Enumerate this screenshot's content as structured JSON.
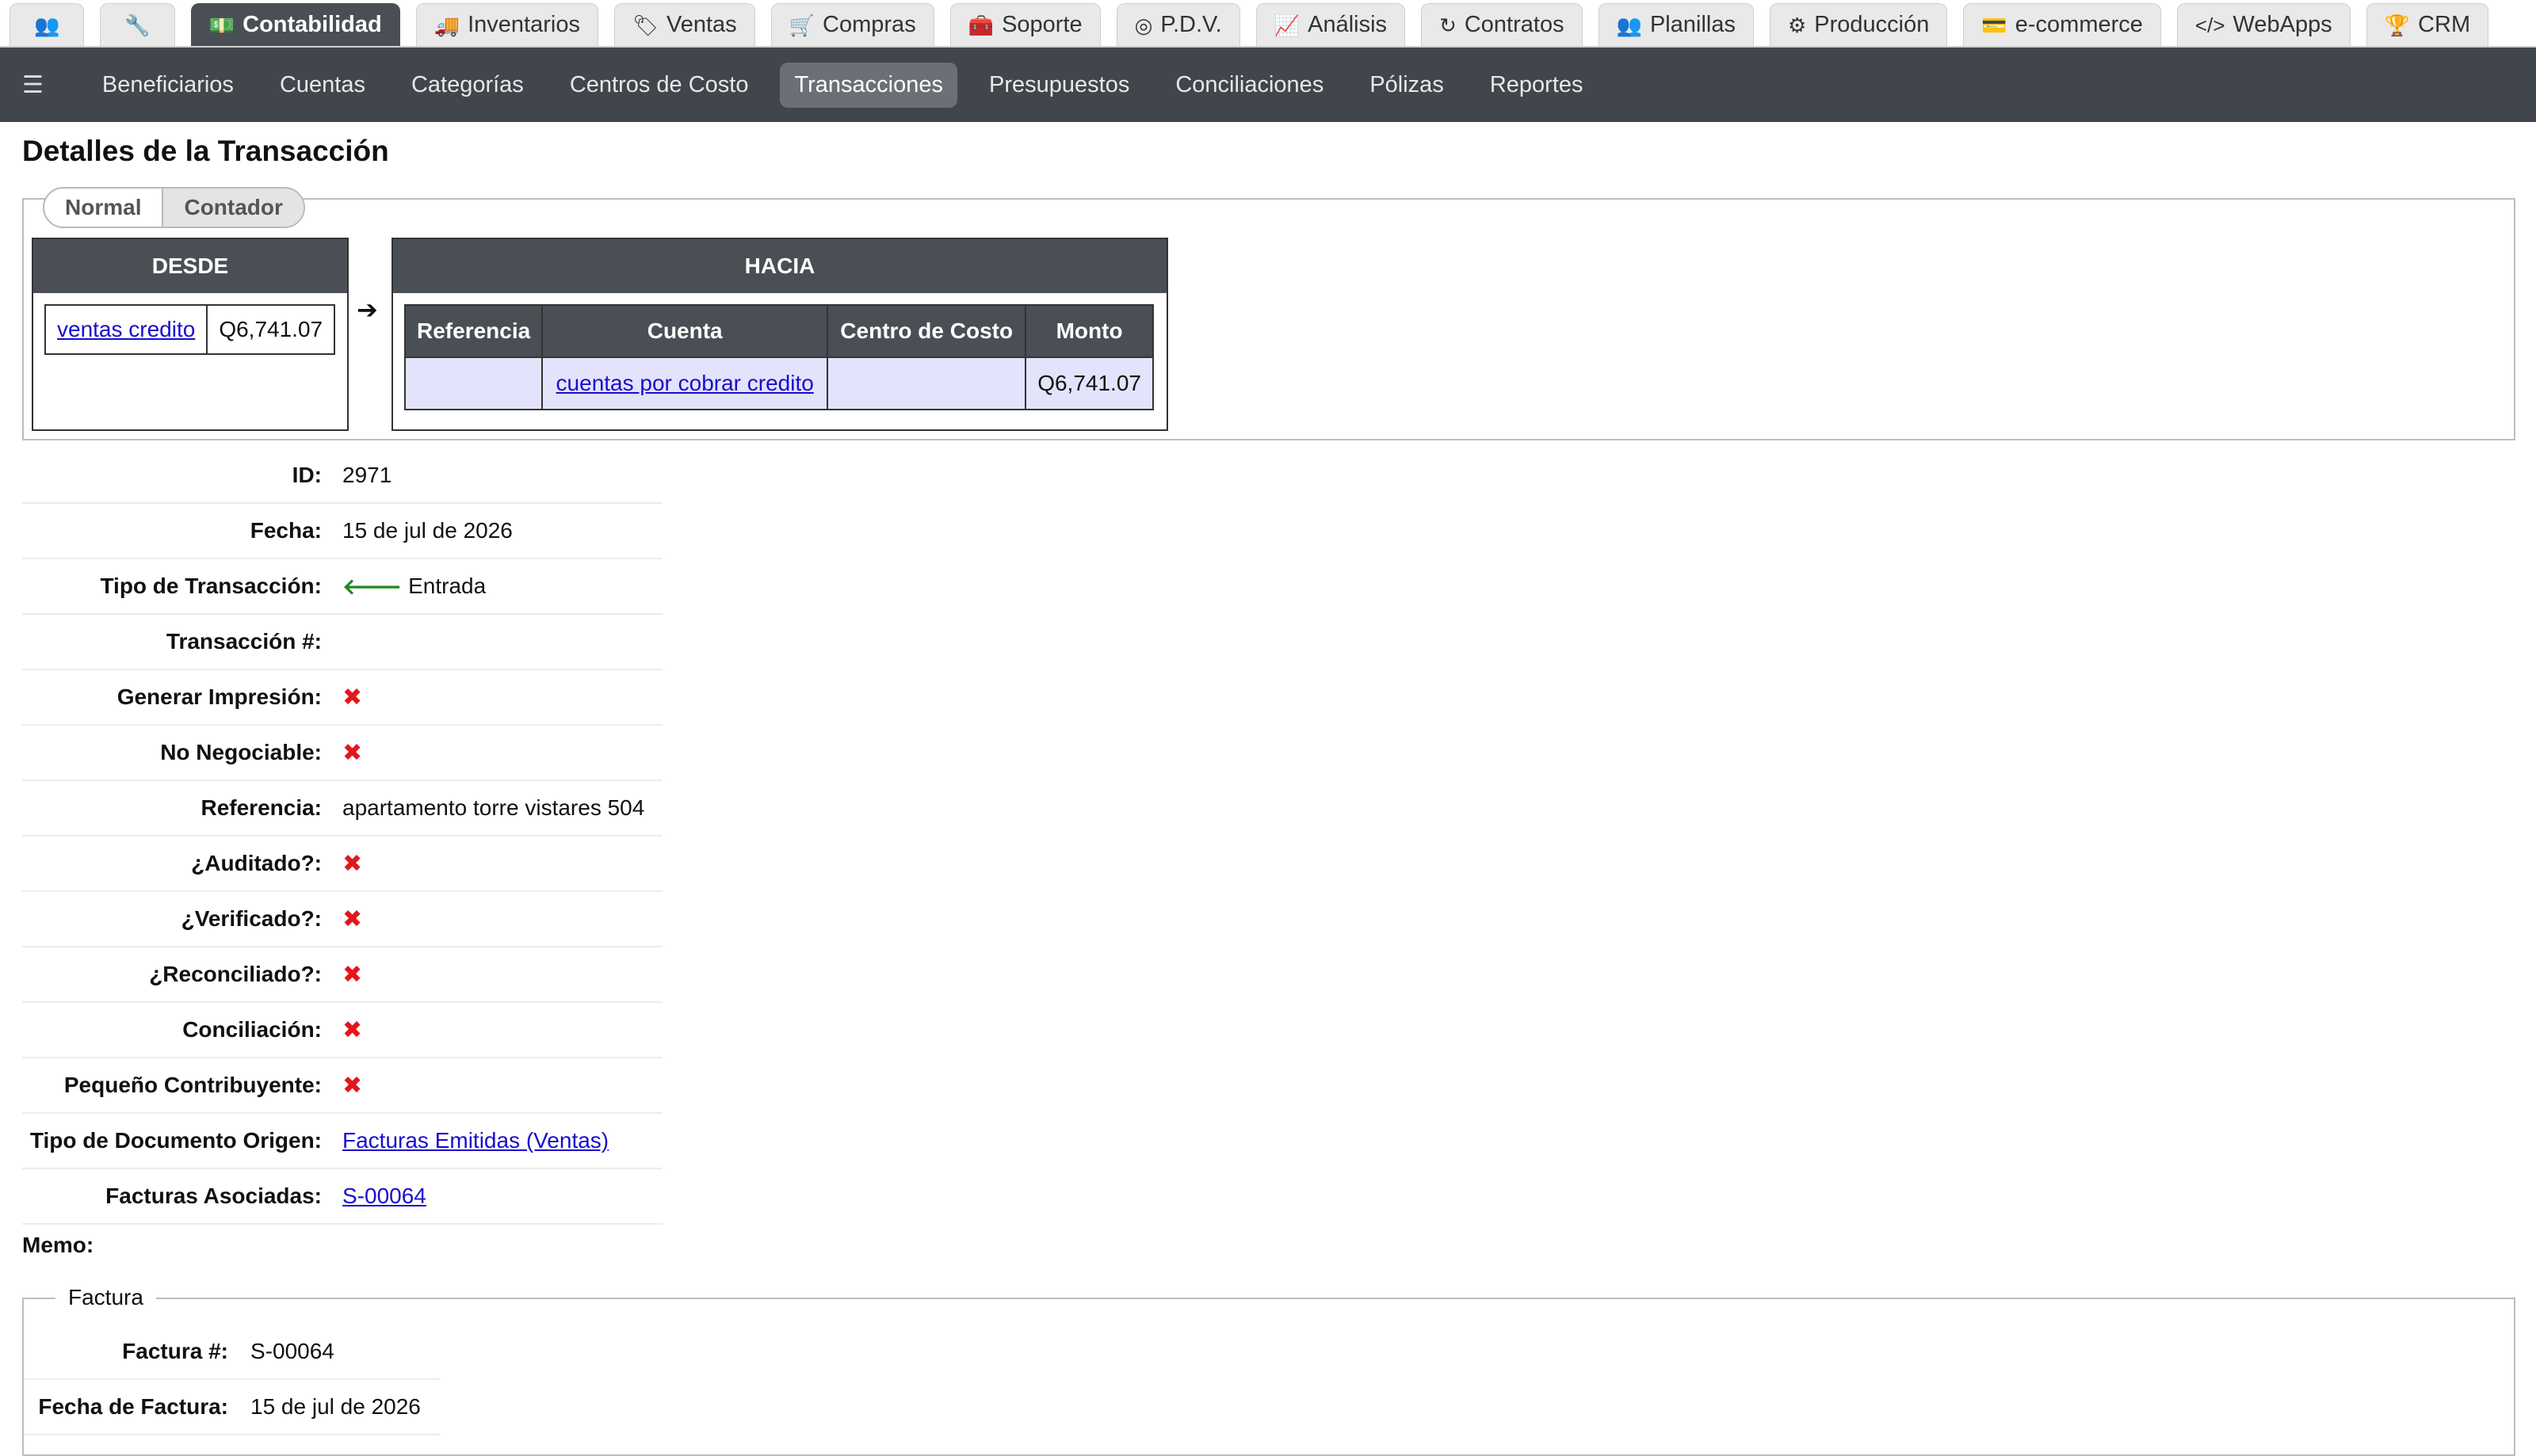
{
  "top_tabs": [
    {
      "name": "users-icon",
      "label": "",
      "icon": "👥"
    },
    {
      "name": "wrench-icon",
      "label": "",
      "icon": "🔧"
    },
    {
      "name": "accounting-icon",
      "label": "Contabilidad",
      "icon": "💵",
      "active": true
    },
    {
      "name": "truck-icon",
      "label": "Inventarios",
      "icon": "🚚"
    },
    {
      "name": "tag-icon",
      "label": "Ventas",
      "icon": "🏷"
    },
    {
      "name": "cart-icon",
      "label": "Compras",
      "icon": "🛒"
    },
    {
      "name": "medkit-icon",
      "label": "Soporte",
      "icon": "🧰"
    },
    {
      "name": "pos-icon",
      "label": "P.D.V.",
      "icon": "◎"
    },
    {
      "name": "chart-icon",
      "label": "Análisis",
      "icon": "📈"
    },
    {
      "name": "refresh-icon",
      "label": "Contratos",
      "icon": "↻"
    },
    {
      "name": "people-icon",
      "label": "Planillas",
      "icon": "👥"
    },
    {
      "name": "gears-icon",
      "label": "Producción",
      "icon": "⚙"
    },
    {
      "name": "card-icon",
      "label": "e-commerce",
      "icon": "💳"
    },
    {
      "name": "code-icon",
      "label": "WebApps",
      "icon": "</>"
    },
    {
      "name": "trophy-icon",
      "label": "CRM",
      "icon": "🏆"
    }
  ],
  "sub_nav": {
    "items": [
      "Beneficiarios",
      "Cuentas",
      "Categorías",
      "Centros de Costo",
      "Transacciones",
      "Presupuestos",
      "Conciliaciones",
      "Pólizas",
      "Reportes"
    ],
    "active_index": 4
  },
  "page": {
    "title": "Detalles de la Transacción",
    "view_options": [
      "Normal",
      "Contador"
    ]
  },
  "desde": {
    "title": "DESDE",
    "account": "ventas credito",
    "amount": "Q6,741.07"
  },
  "hacia": {
    "title": "HACIA",
    "headers": [
      "Referencia",
      "Cuenta",
      "Centro de Costo",
      "Monto"
    ],
    "row": {
      "referencia": "",
      "cuenta": "cuentas por cobrar credito",
      "centro": "",
      "monto": "Q6,741.07"
    }
  },
  "details": [
    {
      "label": "ID:",
      "value": "2971",
      "type": "text"
    },
    {
      "label": "Fecha:",
      "value": "15 de jul de 2026",
      "type": "text"
    },
    {
      "label": "Tipo de Transacción:",
      "value": "Entrada",
      "type": "entrada"
    },
    {
      "label": "Transacción #:",
      "value": "",
      "type": "text"
    },
    {
      "label": "Generar Impresión:",
      "value": "",
      "type": "x"
    },
    {
      "label": "No Negociable:",
      "value": "",
      "type": "x"
    },
    {
      "label": "Referencia:",
      "value": "apartamento torre vistares 504",
      "type": "text"
    },
    {
      "label": "¿Auditado?:",
      "value": "",
      "type": "x"
    },
    {
      "label": "¿Verificado?:",
      "value": "",
      "type": "x"
    },
    {
      "label": "¿Reconciliado?:",
      "value": "",
      "type": "x"
    },
    {
      "label": "Conciliación:",
      "value": "",
      "type": "x"
    },
    {
      "label": "Pequeño Contribuyente:",
      "value": "",
      "type": "x"
    },
    {
      "label": "Tipo de Documento Origen:",
      "value": "Facturas Emitidas (Ventas)",
      "type": "link"
    },
    {
      "label": "Facturas Asociadas:",
      "value": "S-00064",
      "type": "link"
    }
  ],
  "memo_label": "Memo:",
  "factura": {
    "legend": "Factura",
    "rows": [
      {
        "label": "Factura #:",
        "value": "S-00064"
      },
      {
        "label": "Fecha de Factura:",
        "value": "15 de jul de 2026"
      }
    ]
  },
  "colors": {
    "dark_header": "#4a4f55",
    "subnav_bg": "#40464c",
    "link": "#1a0dcc",
    "x_red": "#e3161c",
    "entrada_green": "#1f8a1f",
    "row_highlight": "#e3e3fb"
  }
}
